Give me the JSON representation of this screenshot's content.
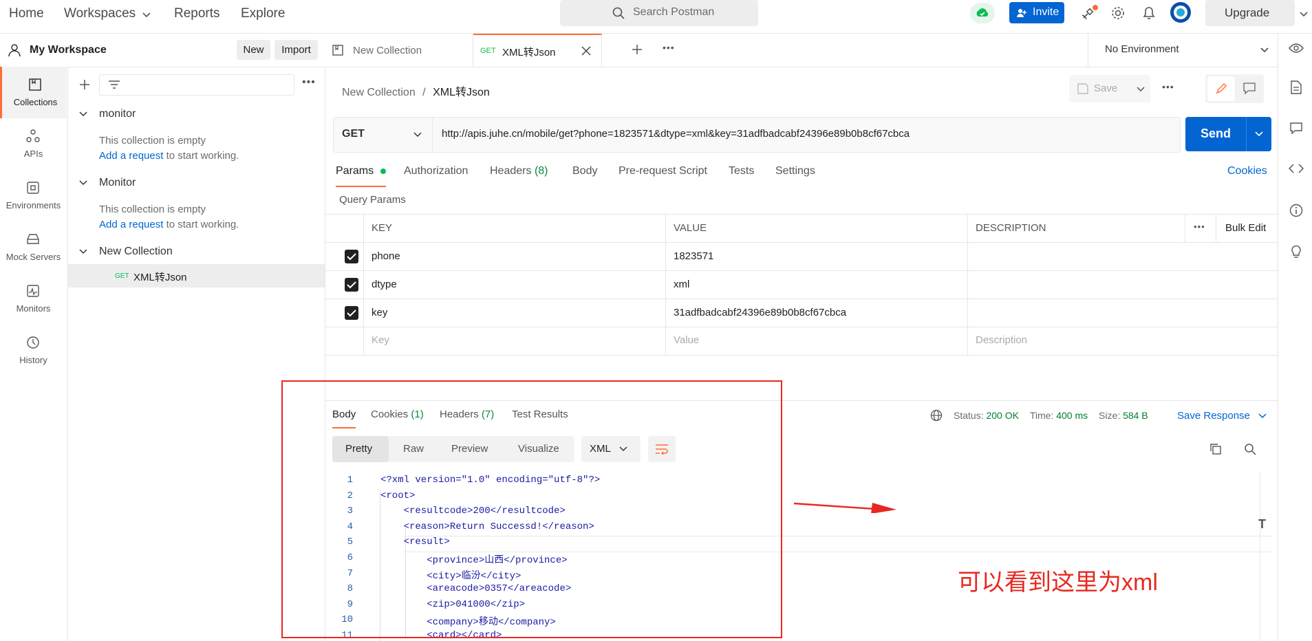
{
  "nav": {
    "home": "Home",
    "workspaces": "Workspaces",
    "reports": "Reports",
    "explore": "Explore",
    "search_placeholder": "Search Postman",
    "invite": "Invite",
    "upgrade": "Upgrade"
  },
  "workspace": {
    "title": "My Workspace",
    "new": "New",
    "import": "Import"
  },
  "sidebar": {
    "items": [
      {
        "label": "Collections",
        "icon": "collections-icon"
      },
      {
        "label": "APIs",
        "icon": "apis-icon"
      },
      {
        "label": "Environments",
        "icon": "environments-icon"
      },
      {
        "label": "Mock Servers",
        "icon": "mock-servers-icon"
      },
      {
        "label": "Monitors",
        "icon": "monitors-icon"
      },
      {
        "label": "History",
        "icon": "history-icon"
      }
    ]
  },
  "tree": {
    "collections": [
      {
        "name": "monitor",
        "empty": "This collection is empty",
        "add": "Add a request",
        "rest": " to start working."
      },
      {
        "name": "Monitor",
        "empty": "This collection is empty",
        "add": "Add a request",
        "rest": " to start working."
      },
      {
        "name": "New Collection",
        "request_method": "GET",
        "request_name": "XML转Json"
      }
    ]
  },
  "tabs": [
    {
      "label": "New Collection"
    },
    {
      "method": "GET",
      "label": "XML转Json"
    }
  ],
  "environment": "No Environment",
  "breadcrumb": {
    "parent": "New Collection",
    "sep": "/",
    "current": "XML转Json"
  },
  "save": "Save",
  "request": {
    "method": "GET",
    "url": "http://apis.juhe.cn/mobile/get?phone=1823571&dtype=xml&key=31adfbadcabf24396e89b0b8cf67cbca",
    "send": "Send"
  },
  "reqtabs": {
    "params": "Params",
    "authorization": "Authorization",
    "headers": "Headers",
    "headers_count": "(8)",
    "body": "Body",
    "prerequest": "Pre-request Script",
    "tests": "Tests",
    "settings": "Settings",
    "cookies": "Cookies"
  },
  "query_params": {
    "title": "Query Params",
    "headers": {
      "key": "KEY",
      "value": "VALUE",
      "description": "DESCRIPTION",
      "bulk": "Bulk Edit"
    },
    "rows": [
      {
        "key": "phone",
        "value": "1823571"
      },
      {
        "key": "dtype",
        "value": "xml"
      },
      {
        "key": "key",
        "value": "31adfbadcabf24396e89b0b8cf67cbca"
      }
    ],
    "placeholders": {
      "key": "Key",
      "value": "Value",
      "description": "Description"
    }
  },
  "response": {
    "tabs": {
      "body": "Body",
      "cookies": "Cookies",
      "cookies_count": "(1)",
      "headers": "Headers",
      "headers_count": "(7)",
      "tests": "Test Results"
    },
    "status_label": "Status:",
    "status": "200 OK",
    "time_label": "Time:",
    "time": "400 ms",
    "size_label": "Size:",
    "size": "584 B",
    "save_response": "Save Response",
    "views": {
      "pretty": "Pretty",
      "raw": "Raw",
      "preview": "Preview",
      "visualize": "Visualize"
    },
    "format": "XML"
  },
  "code_lines": [
    {
      "n": "1",
      "t": "<?xml version=\"1.0\" encoding=\"utf-8\"?>"
    },
    {
      "n": "2",
      "t": "<root>"
    },
    {
      "n": "3",
      "t": "    <resultcode>200</resultcode>"
    },
    {
      "n": "4",
      "t": "    <reason>Return Successd!</reason>"
    },
    {
      "n": "5",
      "t": "    <result>"
    },
    {
      "n": "6",
      "t": "        <province>山西</province>"
    },
    {
      "n": "7",
      "t": "        <city>临汾</city>"
    },
    {
      "n": "8",
      "t": "        <areacode>0357</areacode>"
    },
    {
      "n": "9",
      "t": "        <zip>041000</zip>"
    },
    {
      "n": "10",
      "t": "        <company>移动</company>"
    },
    {
      "n": "11",
      "t": "        <card></card>"
    }
  ],
  "annotation": {
    "text": "可以看到这里为xml",
    "color": "#e8281f"
  },
  "colors": {
    "accent": "#ff6c37",
    "blue": "#0265d2",
    "green": "#0cbb52",
    "status_green": "#007f31"
  }
}
